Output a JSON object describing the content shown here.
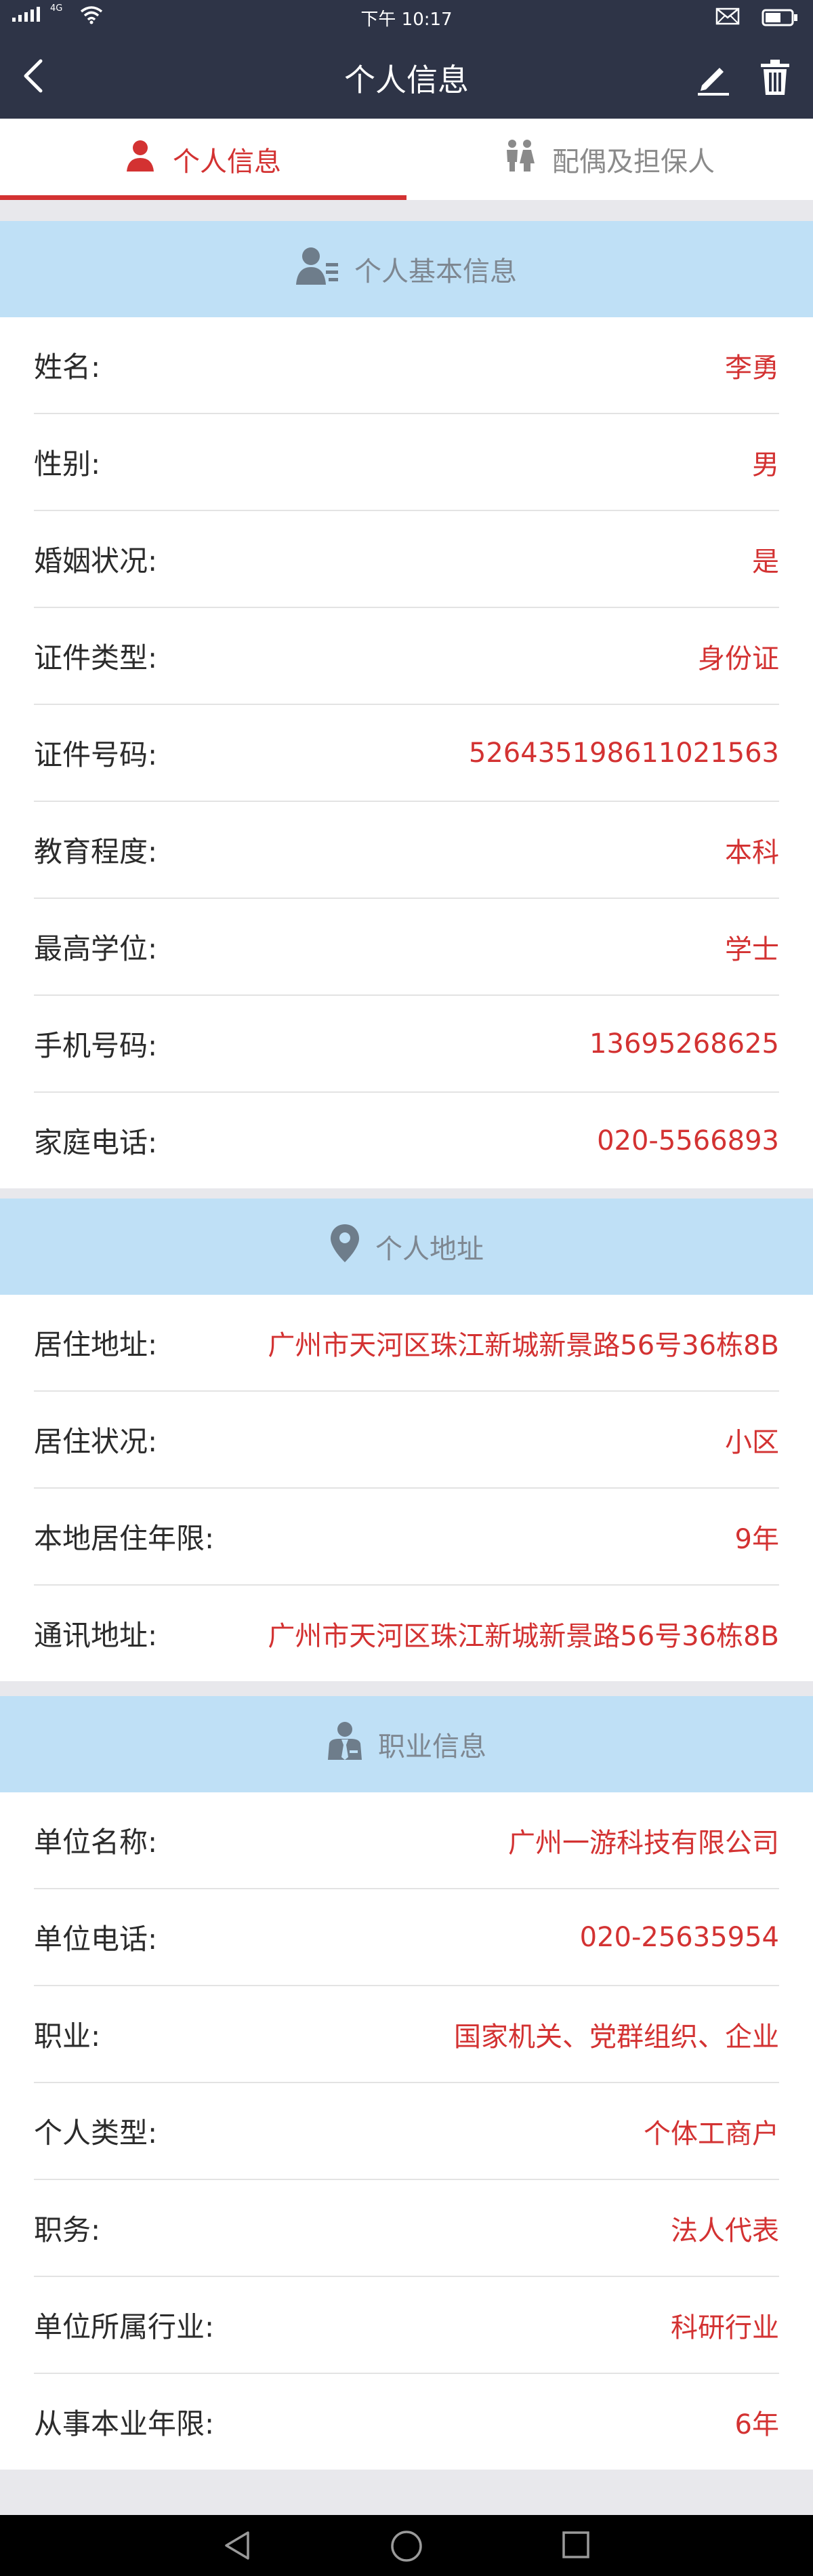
{
  "status_bar": {
    "network": "4G",
    "time": "下午 10:17"
  },
  "header": {
    "title": "个人信息",
    "back_icon": "back-arrow-icon",
    "edit_icon": "pencil-icon",
    "delete_icon": "trash-icon"
  },
  "tabs": [
    {
      "label": "个人信息",
      "icon": "person-icon",
      "active": true
    },
    {
      "label": "配偶及担保人",
      "icon": "couple-icon",
      "active": false
    }
  ],
  "sections": {
    "basic": {
      "title": "个人基本信息",
      "icon": "person-card-icon",
      "rows": [
        {
          "label": "姓名:",
          "value": "李勇"
        },
        {
          "label": "性别:",
          "value": "男"
        },
        {
          "label": "婚姻状况:",
          "value": "是"
        },
        {
          "label": "证件类型:",
          "value": "身份证"
        },
        {
          "label": "证件号码:",
          "value": "526435198611021563"
        },
        {
          "label": "教育程度:",
          "value": "本科"
        },
        {
          "label": "最高学位:",
          "value": "学士"
        },
        {
          "label": "手机号码:",
          "value": "13695268625"
        },
        {
          "label": "家庭电话:",
          "value": "020-5566893"
        }
      ]
    },
    "address": {
      "title": "个人地址",
      "icon": "location-pin-icon",
      "rows": [
        {
          "label": "居住地址:",
          "value": "广州市天河区珠江新城新景路56号36栋8B"
        },
        {
          "label": "居住状况:",
          "value": "小区"
        },
        {
          "label": "本地居住年限:",
          "value": "9年"
        },
        {
          "label": "通讯地址:",
          "value": "广州市天河区珠江新城新景路56号36栋8B"
        }
      ]
    },
    "job": {
      "title": "职业信息",
      "icon": "businessman-icon",
      "rows": [
        {
          "label": "单位名称:",
          "value": "广州一游科技有限公司"
        },
        {
          "label": "单位电话:",
          "value": "020-25635954"
        },
        {
          "label": "职业:",
          "value": "国家机关、党群组织、企业"
        },
        {
          "label": "个人类型:",
          "value": "个体工商户"
        },
        {
          "label": "职务:",
          "value": "法人代表"
        },
        {
          "label": "单位所属行业:",
          "value": "科研行业"
        },
        {
          "label": "从事本业年限:",
          "value": "6年"
        }
      ]
    }
  },
  "colors": {
    "header_bg": "#2e3447",
    "accent": "#d33232",
    "section_bg": "#bfe0f6",
    "page_bg": "#e8e8ec"
  }
}
